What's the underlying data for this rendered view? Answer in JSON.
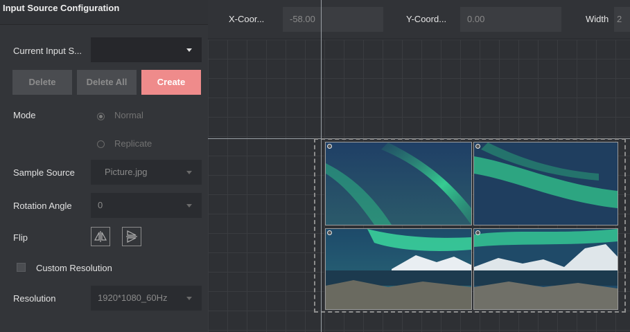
{
  "panel": {
    "title": "Input Source Configuration",
    "current_input_label": "Current Input S...",
    "current_input_value": "",
    "buttons": {
      "delete": "Delete",
      "delete_all": "Delete All",
      "create": "Create"
    },
    "mode": {
      "label": "Mode",
      "options": [
        "Normal",
        "Replicate"
      ],
      "selected": "Normal"
    },
    "sample_source": {
      "label": "Sample Source",
      "value": "Picture.jpg"
    },
    "rotation": {
      "label": "Rotation Angle",
      "value": "0"
    },
    "flip": {
      "label": "Flip"
    },
    "custom_resolution": {
      "label": "Custom Resolution",
      "checked": false
    },
    "resolution": {
      "label": "Resolution",
      "value": "1920*1080_60Hz"
    }
  },
  "topbar": {
    "x_label": "X-Coor...",
    "x_value": "-58.00",
    "y_label": "Y-Coord...",
    "y_value": "0.00",
    "width_label": "Width",
    "width_value": "2"
  },
  "colors": {
    "accent": "#ef8b8b",
    "panel": "#333539",
    "canvas": "#2e3034"
  }
}
